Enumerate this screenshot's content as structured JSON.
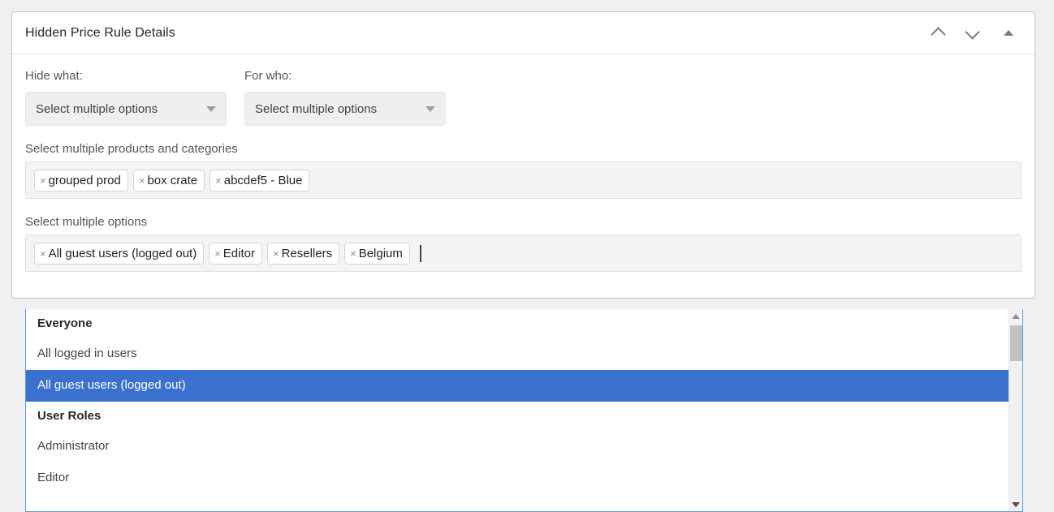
{
  "panel": {
    "title": "Hidden Price Rule Details",
    "header_icons": [
      {
        "name": "move-up-icon",
        "glyph": "chevron-up"
      },
      {
        "name": "move-down-icon",
        "glyph": "chevron-down"
      },
      {
        "name": "collapse-toggle-icon",
        "glyph": "triangle-up"
      }
    ]
  },
  "selects": [
    {
      "label": "Hide what:",
      "value": "Select multiple options"
    },
    {
      "label": "For who:",
      "value": "Select multiple options"
    }
  ],
  "products_field": {
    "label": "Select multiple products and categories",
    "tags": [
      "grouped prod",
      "box crate",
      "abcdef5 - Blue"
    ],
    "remove_glyph": "×"
  },
  "who_field": {
    "label": "Select multiple options",
    "tags": [
      "All guest users (logged out)",
      "Editor",
      "Resellers",
      "Belgium"
    ],
    "remove_glyph": "×",
    "input_value": ""
  },
  "dropdown": {
    "items": [
      {
        "type": "group",
        "label": "Everyone"
      },
      {
        "type": "option",
        "label": "All logged in users",
        "selected": false
      },
      {
        "type": "option",
        "label": "All guest users (logged out)",
        "selected": true
      },
      {
        "type": "group",
        "label": "User Roles"
      },
      {
        "type": "option",
        "label": "Administrator",
        "selected": false
      },
      {
        "type": "option",
        "label": "Editor",
        "selected": false
      }
    ]
  },
  "colors": {
    "highlight": "#3a71cf",
    "focus_border": "#5b9dd9",
    "page_bg": "#f0f0f1",
    "field_bg": "#f4f4f4"
  }
}
